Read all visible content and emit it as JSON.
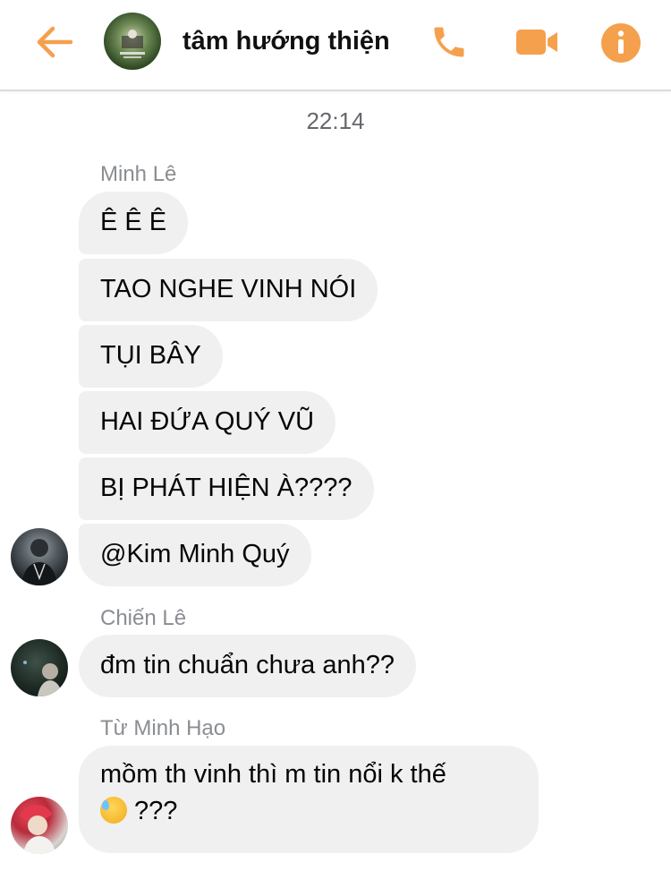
{
  "header": {
    "title": "tâm hướng thiện",
    "accent_color": "#f5a04d",
    "back_icon": "arrow-left-icon",
    "call_icon": "phone-icon",
    "video_icon": "video-camera-icon",
    "info_icon": "info-icon"
  },
  "timestamp": "22:14",
  "groups": [
    {
      "sender": "Minh Lê",
      "messages": [
        "Ê Ê Ê",
        "TAO NGHE VINH NÓI",
        "TỤI BÂY",
        "HAI ĐỨA QUÝ VŨ",
        "BỊ PHÁT HIỆN À????",
        "@Kim Minh Quý"
      ]
    },
    {
      "sender": "Chiến Lê",
      "messages": [
        "đm tin chuẩn chưa anh??"
      ]
    },
    {
      "sender": "Từ Minh Hạo",
      "messages": [
        {
          "line1": "mồm th vinh thì m tin nổi k thế",
          "emoji": "downcast-face-with-sweat-emoji",
          "line2": "???"
        }
      ]
    }
  ]
}
